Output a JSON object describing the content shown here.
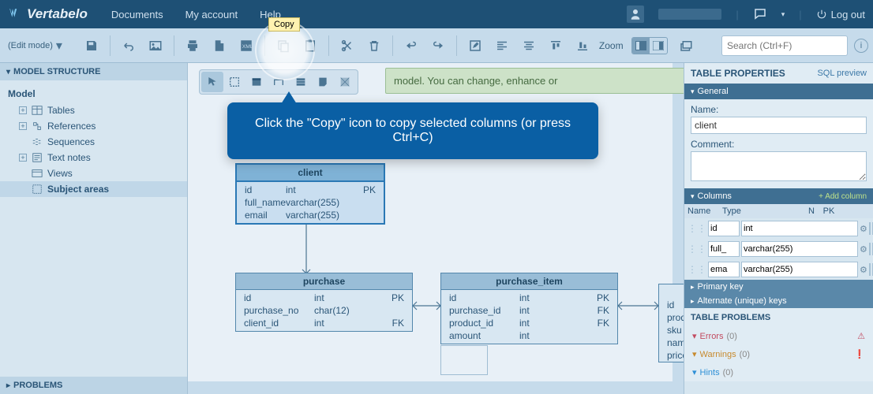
{
  "brand": "Vertabelo",
  "topnav": {
    "documents": "Documents",
    "my_account": "My account",
    "help": "Help",
    "logout": "Log out"
  },
  "toolbar": {
    "edit_mode": "(Edit mode)",
    "zoom_label": "Zoom",
    "search_placeholder": "Search (Ctrl+F)",
    "copy_tooltip": "Copy"
  },
  "left": {
    "structure_title": "MODEL STRUCTURE",
    "model_root": "Model",
    "items": [
      {
        "label": "Tables"
      },
      {
        "label": "References"
      },
      {
        "label": "Sequences"
      },
      {
        "label": "Text notes"
      },
      {
        "label": "Views"
      },
      {
        "label": "Subject areas"
      }
    ],
    "problems_title": "PROBLEMS"
  },
  "canvas": {
    "note_text": "model. You can change, enhance or",
    "entities": {
      "client": {
        "name": "client",
        "cols": [
          {
            "name": "id",
            "type": "int",
            "key": "PK"
          },
          {
            "name": "full_name",
            "type": "varchar(255)",
            "key": ""
          },
          {
            "name": "email",
            "type": "varchar(255)",
            "key": ""
          }
        ]
      },
      "purchase": {
        "name": "purchase",
        "cols": [
          {
            "name": "id",
            "type": "int",
            "key": "PK"
          },
          {
            "name": "purchase_no",
            "type": "char(12)",
            "key": ""
          },
          {
            "name": "client_id",
            "type": "int",
            "key": "FK"
          }
        ]
      },
      "purchase_item": {
        "name": "purchase_item",
        "cols": [
          {
            "name": "id",
            "type": "int",
            "key": "PK"
          },
          {
            "name": "purchase_id",
            "type": "int",
            "key": "FK"
          },
          {
            "name": "product_id",
            "type": "int",
            "key": "FK"
          },
          {
            "name": "amount",
            "type": "int",
            "key": ""
          }
        ]
      },
      "product_frag": {
        "name": "",
        "cols": [
          {
            "name": "id"
          },
          {
            "name": "prod"
          },
          {
            "name": "sku"
          },
          {
            "name": "name"
          },
          {
            "name": "price"
          }
        ]
      }
    }
  },
  "callout": "Click the \"Copy\" icon to copy selected columns (or press Ctrl+C)",
  "right": {
    "title": "TABLE PROPERTIES",
    "sql_preview": "SQL preview",
    "general": "General",
    "name_label": "Name:",
    "name_value": "client",
    "comment_label": "Comment:",
    "columns_hdr": "Columns",
    "add_column": "+ Add column",
    "col_name": "Name",
    "col_type": "Type",
    "col_n": "N",
    "col_pk": "PK",
    "rows": [
      {
        "name": "id",
        "type": "int",
        "n": false,
        "pk": true
      },
      {
        "name": "full_",
        "type": "varchar(255)",
        "n": false,
        "pk": false
      },
      {
        "name": "ema",
        "type": "varchar(255)",
        "n": false,
        "pk": false
      }
    ],
    "primary_key": "Primary key",
    "alternate_keys": "Alternate (unique) keys",
    "table_problems": "TABLE PROBLEMS",
    "errors_label": "Errors",
    "errors_count": "(0)",
    "warnings_label": "Warnings",
    "warnings_count": "(0)",
    "hints_label": "Hints",
    "hints_count": "(0)"
  }
}
